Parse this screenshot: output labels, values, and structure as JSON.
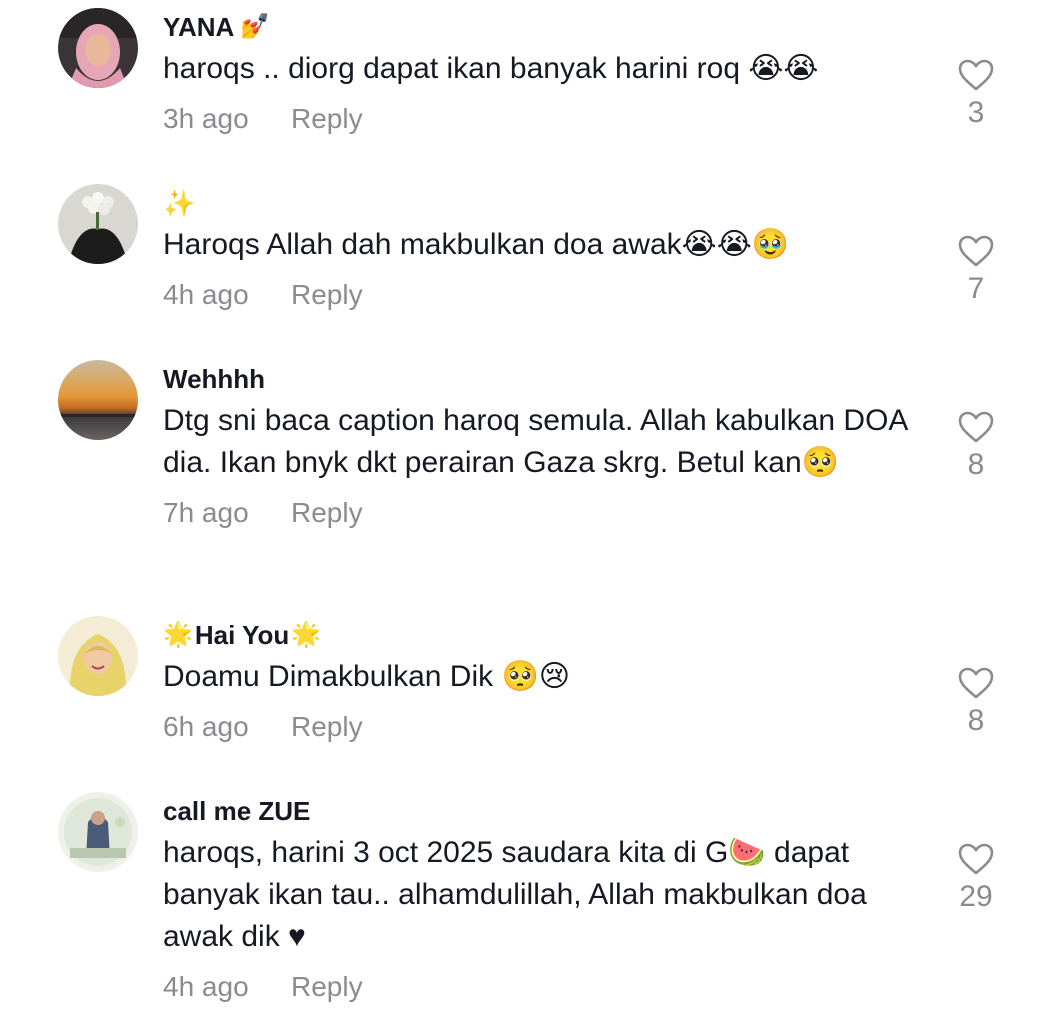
{
  "comments": [
    {
      "username": "YANA",
      "username_deco": "💅",
      "text": "haroqs .. diorg dapat ikan banyak harini roq 😭😭",
      "time": "3h ago",
      "reply_label": "Reply",
      "likes": "3"
    },
    {
      "username": "✨",
      "text": "Haroqs Allah dah makbulkan doa awak😭😭🥹",
      "time": "4h ago",
      "reply_label": "Reply",
      "likes": "7"
    },
    {
      "username": "Wehhhh",
      "text": "Dtg sni baca caption haroq semula. Allah kabulkan DOA dia. Ikan bnyk dkt perairan Gaza skrg. Betul kan🥺",
      "time": "7h ago",
      "reply_label": "Reply",
      "likes": "8"
    },
    {
      "username": "Hai You",
      "username_prefix": "🌟",
      "username_deco": "🌟",
      "text": "Doamu Dimakbulkan Dik 🥺😢",
      "time": "6h ago",
      "reply_label": "Reply",
      "likes": "8"
    },
    {
      "username": "call me ZUE",
      "text": "haroqs, harini 3 oct 2025 saudara kita di G🍉 dapat banyak ikan tau.. alhamdulillah, Allah makbulkan doa awak dik ♥",
      "time": "4h ago",
      "reply_label": "Reply",
      "likes": "29"
    }
  ],
  "icons": {
    "like": "heart-outline-icon"
  },
  "colors": {
    "text": "#161823",
    "muted": "#8a8b91"
  }
}
